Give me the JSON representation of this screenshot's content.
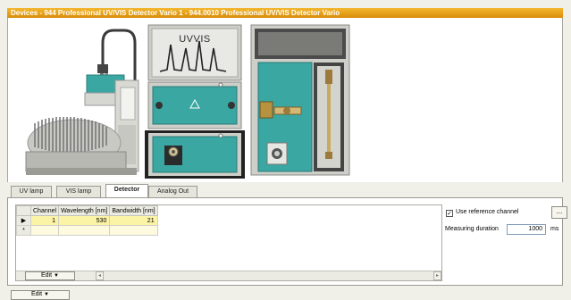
{
  "window": {
    "title": "Devices - 944 Professional UV/VIS Detector Vario 1 - 944.0010 Professional UV/VIS Detector  Vario"
  },
  "device_image": {
    "module_label": "UVVIS",
    "colors": {
      "teal": "#3ba7a2",
      "dark": "#3b3b3b",
      "frame": "#cfcfca"
    }
  },
  "tabs": [
    {
      "label": "UV lamp",
      "active": false
    },
    {
      "label": "VIS lamp",
      "active": false
    },
    {
      "label": "Detector",
      "active": true
    },
    {
      "label": "Analog Out",
      "active": false
    }
  ],
  "grid": {
    "columns": [
      "Channel",
      "Wavelength [nm]",
      "Bandwidth [nm]"
    ],
    "rows": [
      {
        "marker": "▶",
        "channel": "1",
        "wavelength": "530",
        "bandwidth": "21"
      },
      {
        "marker": "*",
        "channel": "",
        "wavelength": "",
        "bandwidth": ""
      }
    ],
    "edit_label": "Edit"
  },
  "settings": {
    "use_reference_channel": {
      "label": "Use reference channel",
      "checked": true
    },
    "more_button": "...",
    "measuring_duration": {
      "label": "Measuring duration",
      "value": "1000",
      "unit": "ms"
    }
  },
  "footer": {
    "edit_label": "Edit"
  }
}
